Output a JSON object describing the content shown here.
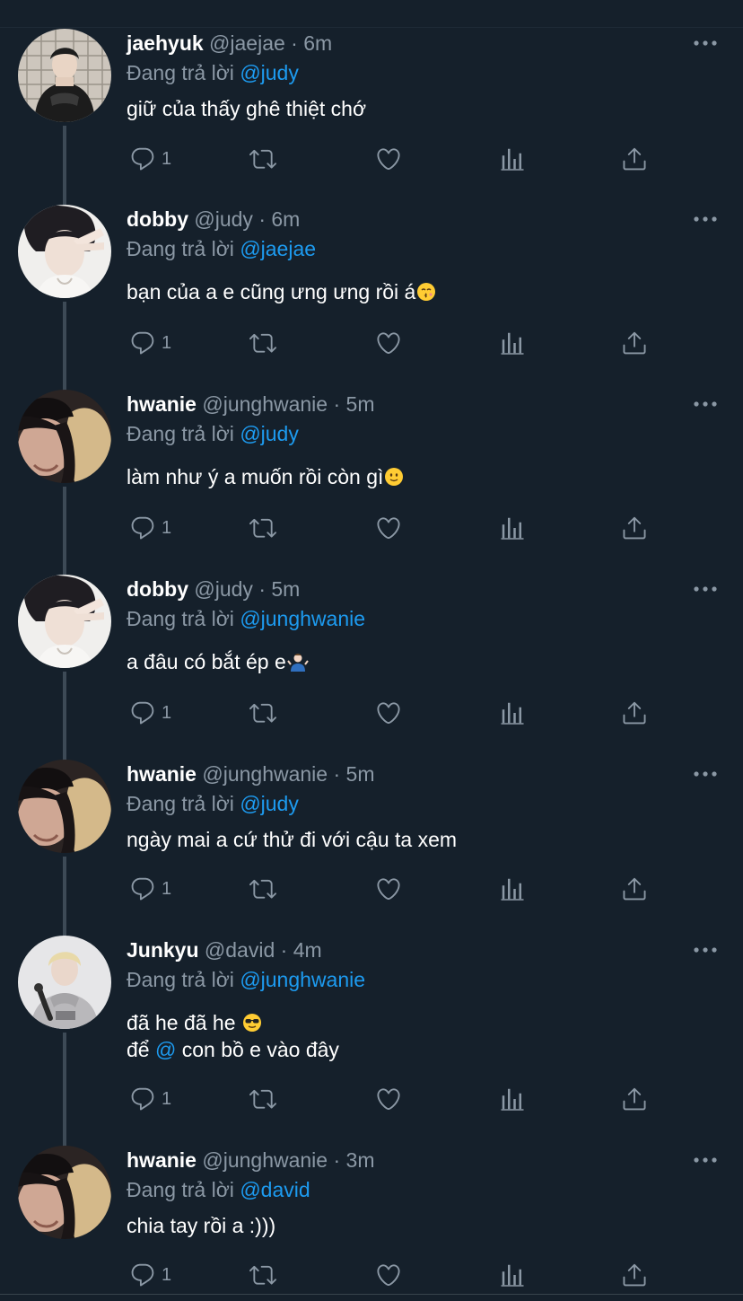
{
  "reply_prefix": "Đang trả lời",
  "colors": {
    "background": "#15202b",
    "text_primary": "#ffffff",
    "text_secondary": "#8b98a5",
    "mention": "#1d9bf0",
    "thread_line": "#3d4a56"
  },
  "action_icons": [
    "reply-icon",
    "retweet-icon",
    "like-icon",
    "analytics-icon",
    "share-icon"
  ],
  "tweets": [
    {
      "name": "jaehyuk",
      "handle": "@jaejae",
      "separator": "·",
      "time": "6m",
      "reply_to": "@judy",
      "lines": [
        "giữ của thấy ghê thiệt chớ"
      ],
      "reply_count": "1",
      "avatar": "avatar-jaehyuk"
    },
    {
      "name": "dobby",
      "handle": "@judy",
      "separator": "·",
      "time": "6m",
      "reply_to": "@jaejae",
      "lines": [
        "bạn của a e cũng ưng ưng rồi á"
      ],
      "emoji": "kissing-face-emoji",
      "reply_count": "1",
      "avatar": "avatar-dobby"
    },
    {
      "name": "hwanie",
      "handle": "@junghwanie",
      "separator": "·",
      "time": "5m",
      "reply_to": "@judy",
      "lines": [
        "làm như ý a muốn rồi còn gì"
      ],
      "emoji": "slightly-smiling-face-emoji",
      "reply_count": "1",
      "avatar": "avatar-hwanie"
    },
    {
      "name": "dobby",
      "handle": "@judy",
      "separator": "·",
      "time": "5m",
      "reply_to": "@junghwanie",
      "lines": [
        "a đâu có bắt ép e"
      ],
      "emoji": "person-shrugging-emoji",
      "reply_count": "1",
      "avatar": "avatar-dobby"
    },
    {
      "name": "hwanie",
      "handle": "@junghwanie",
      "separator": "·",
      "time": "5m",
      "reply_to": "@judy",
      "lines": [
        "ngày mai a cứ thử đi với cậu ta xem"
      ],
      "reply_count": "1",
      "avatar": "avatar-hwanie"
    },
    {
      "name": "Junkyu",
      "handle": "@david",
      "separator": "·",
      "time": "4m",
      "reply_to": "@junghwanie",
      "lines": [
        "đã he đã he ",
        "để "
      ],
      "line2_mention": "@",
      "line2_rest": " con bồ e vào đây",
      "emoji": "sunglasses-face-emoji",
      "reply_count": "1",
      "avatar": "avatar-junkyu"
    },
    {
      "name": "hwanie",
      "handle": "@junghwanie",
      "separator": "·",
      "time": "3m",
      "reply_to": "@david",
      "lines": [
        "chia tay rồi a :)))"
      ],
      "reply_count": "1",
      "avatar": "avatar-hwanie"
    }
  ]
}
